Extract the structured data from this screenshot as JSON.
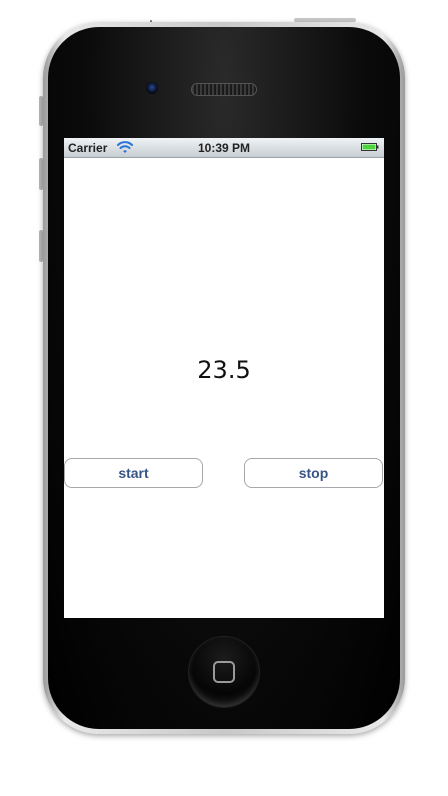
{
  "status_bar": {
    "carrier": "Carrier",
    "time": "10:39 PM",
    "wifi_icon": "wifi-icon",
    "battery_icon": "battery-icon",
    "battery_color": "#4cd43c"
  },
  "main": {
    "value": "23.5"
  },
  "buttons": {
    "start_label": "start",
    "stop_label": "stop",
    "label_color": "#385487"
  },
  "device": {
    "home_icon": "home-button-icon"
  }
}
